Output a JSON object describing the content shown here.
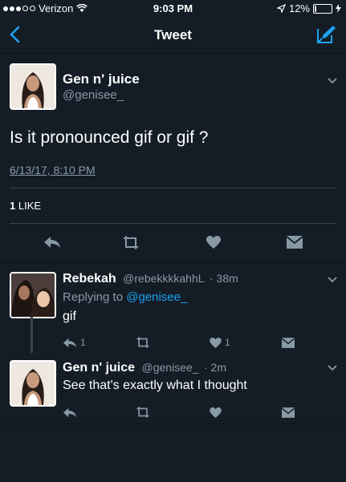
{
  "status_bar": {
    "carrier": "Verizon",
    "time": "9:03 PM",
    "battery": "12%",
    "battery_fraction": 0.12
  },
  "nav": {
    "title": "Tweet"
  },
  "main_tweet": {
    "name": "Gen n' juice",
    "handle": "@genisee_",
    "text": "Is it pronounced gif or gif ?",
    "timestamp": "6/13/17, 8:10 PM",
    "likes_count": "1",
    "likes_label": "LIKE"
  },
  "replies": [
    {
      "name": "Rebekah",
      "handle": "@rebekkkkahhL",
      "time": "· 38m",
      "replying_prefix": "Replying to",
      "replying_to": "@genisee_",
      "text": "gif",
      "reply_count": "1",
      "like_count": "1"
    },
    {
      "name": "Gen n' juice",
      "handle": "@genisee_",
      "time": "· 2m",
      "text": "See that's exactly what I thought"
    }
  ],
  "colors": {
    "background": "#141d26",
    "secondary_text": "#8899a6",
    "accent": "#1da1f2",
    "divider": "#38444d"
  },
  "icons": [
    "back-chevron-icon",
    "compose-icon",
    "reply-icon",
    "retweet-icon",
    "heart-icon",
    "dm-icon",
    "caret-down-icon"
  ]
}
